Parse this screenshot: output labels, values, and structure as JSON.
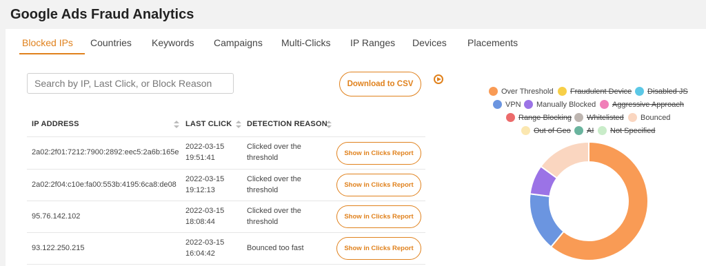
{
  "app": {
    "title": "Google Ads Fraud Analytics"
  },
  "tabs": [
    {
      "label": "Blocked IPs",
      "active": true
    },
    {
      "label": "Countries"
    },
    {
      "label": "Keywords"
    },
    {
      "label": "Campaigns"
    },
    {
      "label": "Multi-Clicks"
    },
    {
      "label": "IP Ranges"
    },
    {
      "label": "Devices"
    },
    {
      "label": "Placements"
    }
  ],
  "search": {
    "placeholder": "Search by IP, Last Click, or Block Reason",
    "value": ""
  },
  "toolbar": {
    "download_label": "Download to CSV",
    "help_icon": "play-circle-icon"
  },
  "table": {
    "columns": [
      "IP ADDRESS",
      "LAST CLICK",
      "DETECTION REASON"
    ],
    "report_button_label": "Show in Clicks Report",
    "rows": [
      {
        "ip": "2a02:2f01:7212:7900:2892:eec5:2a6b:165e",
        "date": "2022-03-15",
        "time": "19:51:41",
        "reason": "Clicked over the threshold"
      },
      {
        "ip": "2a02:2f04:c10e:fa00:553b:4195:6ca8:de08",
        "date": "2022-03-15",
        "time": "19:12:13",
        "reason": "Clicked over the threshold"
      },
      {
        "ip": "95.76.142.102",
        "date": "2022-03-15",
        "time": "18:08:44",
        "reason": "Clicked over the threshold"
      },
      {
        "ip": "93.122.250.215",
        "date": "2022-03-15",
        "time": "16:04:42",
        "reason": "Bounced too fast"
      }
    ]
  },
  "legend": [
    {
      "label": "Over Threshold",
      "color": "#f99b55",
      "enabled": true
    },
    {
      "label": "Fraudulent Device",
      "color": "#f7cf48",
      "enabled": false
    },
    {
      "label": "Disabled JS",
      "color": "#5cc8e6",
      "enabled": false
    },
    {
      "label": "VPN",
      "color": "#6b95e0",
      "enabled": true
    },
    {
      "label": "Manually Blocked",
      "color": "#9b73e6",
      "enabled": true
    },
    {
      "label": "Aggressive Approach",
      "color": "#f07fb8",
      "enabled": false
    },
    {
      "label": "Range Blocking",
      "color": "#ec6b6b",
      "enabled": false
    },
    {
      "label": "Whitelisted",
      "color": "#bdb5b0",
      "enabled": false
    },
    {
      "label": "Bounced",
      "color": "#fad6c0",
      "enabled": true
    },
    {
      "label": "Out of Geo",
      "color": "#fbe7b0",
      "enabled": false
    },
    {
      "label": "AI",
      "color": "#6ab49e",
      "enabled": false
    },
    {
      "label": "Not Specified",
      "color": "#c9ecc9",
      "enabled": false
    }
  ],
  "chart_data": {
    "type": "pie",
    "donut": true,
    "categories": [
      "Over Threshold",
      "VPN",
      "Manually Blocked",
      "Bounced"
    ],
    "values": [
      61,
      16,
      8,
      15
    ],
    "colors": [
      "#f99b55",
      "#6b95e0",
      "#9b73e6",
      "#fad6c0"
    ],
    "legend_position": "top"
  }
}
